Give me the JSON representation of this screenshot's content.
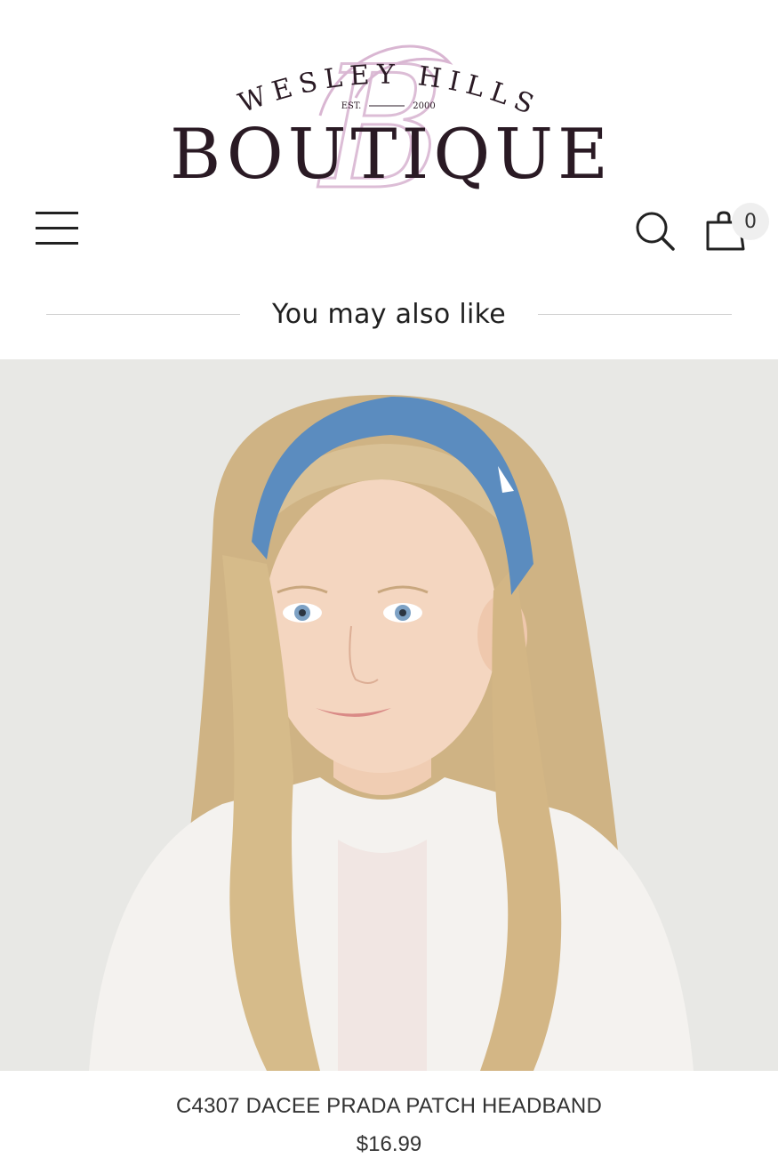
{
  "header": {
    "logo": {
      "line1": "WESLEY HILLS",
      "est_left": "EST.",
      "est_right": "2000",
      "line2": "BOUTIQUE"
    },
    "menu_icon": "hamburger-menu-icon",
    "search_icon": "search-icon",
    "cart_icon": "shopping-bag-icon",
    "cart_count": "0"
  },
  "section": {
    "heading": "You may also like"
  },
  "product": {
    "title": "C4307 DACEE PRADA PATCH HEADBAND",
    "price": "$16.99"
  },
  "colors": {
    "logo_text": "#2a1a24",
    "logo_monogram": "#d9b6d2",
    "headband": "#5b8cbf",
    "photo_background": "#e8e8e5"
  }
}
